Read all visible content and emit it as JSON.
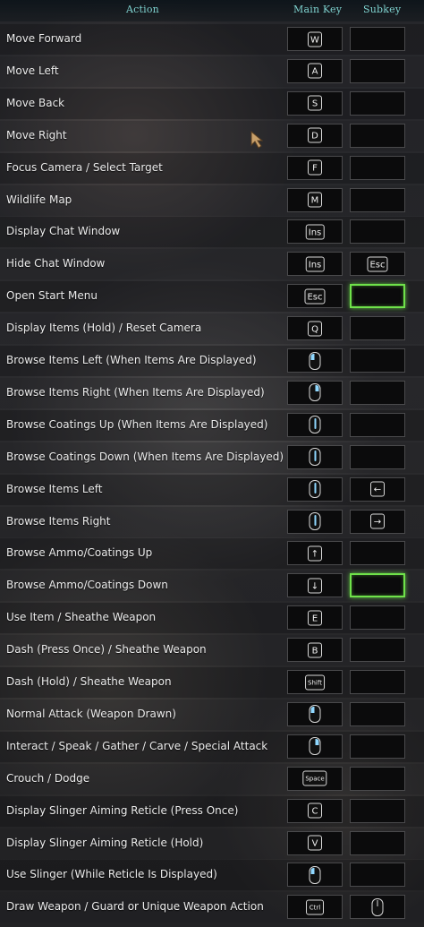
{
  "header": {
    "action": "Action",
    "main_key": "Main Key",
    "subkey": "Subkey"
  },
  "rows": [
    {
      "label": "Move Forward",
      "main": {
        "type": "key",
        "text": "W"
      },
      "sub": null
    },
    {
      "label": "Move Left",
      "main": {
        "type": "key",
        "text": "A"
      },
      "sub": null
    },
    {
      "label": "Move Back",
      "main": {
        "type": "key",
        "text": "S"
      },
      "sub": null
    },
    {
      "label": "Move Right",
      "main": {
        "type": "key",
        "text": "D"
      },
      "sub": null
    },
    {
      "label": "Focus Camera / Select Target",
      "main": {
        "type": "key",
        "text": "F"
      },
      "sub": null
    },
    {
      "label": "Wildlife Map",
      "main": {
        "type": "key",
        "text": "M"
      },
      "sub": null
    },
    {
      "label": "Display Chat Window",
      "main": {
        "type": "key",
        "text": "Ins"
      },
      "sub": null
    },
    {
      "label": "Hide Chat Window",
      "main": {
        "type": "key",
        "text": "Ins"
      },
      "sub": {
        "type": "key",
        "text": "Esc"
      }
    },
    {
      "label": "Open Start Menu",
      "main": {
        "type": "key",
        "text": "Esc"
      },
      "sub": null,
      "sub_selected": true
    },
    {
      "label": "Display Items (Hold) / Reset Camera",
      "main": {
        "type": "key",
        "text": "Q"
      },
      "sub": null
    },
    {
      "label": "Browse Items Left (When Items Are Displayed)",
      "main": {
        "type": "mouse",
        "icon": "mouse-left-click-icon"
      },
      "sub": null
    },
    {
      "label": "Browse Items Right (When Items Are Displayed)",
      "main": {
        "type": "mouse",
        "icon": "mouse-right-click-icon"
      },
      "sub": null
    },
    {
      "label": "Browse Coatings Up (When Items Are Displayed)",
      "main": {
        "type": "mouse",
        "icon": "mouse-wheel-up-icon"
      },
      "sub": null
    },
    {
      "label": "Browse Coatings Down (When Items Are Displayed)",
      "main": {
        "type": "mouse",
        "icon": "mouse-wheel-down-icon"
      },
      "sub": null
    },
    {
      "label": "Browse Items Left",
      "main": {
        "type": "mouse",
        "icon": "mouse-wheel-up-icon"
      },
      "sub": {
        "type": "key",
        "text": "←"
      }
    },
    {
      "label": "Browse Items Right",
      "main": {
        "type": "mouse",
        "icon": "mouse-wheel-down-icon"
      },
      "sub": {
        "type": "key",
        "text": "→"
      }
    },
    {
      "label": "Browse Ammo/Coatings Up",
      "main": {
        "type": "key",
        "text": "↑"
      },
      "sub": null
    },
    {
      "label": "Browse Ammo/Coatings Down",
      "main": {
        "type": "key",
        "text": "↓"
      },
      "sub": null,
      "sub_selected": true
    },
    {
      "label": "Use Item / Sheathe Weapon",
      "main": {
        "type": "key",
        "text": "E"
      },
      "sub": null
    },
    {
      "label": "Dash (Press Once) / Sheathe Weapon",
      "main": {
        "type": "key",
        "text": "B"
      },
      "sub": null
    },
    {
      "label": "Dash (Hold) / Sheathe Weapon",
      "main": {
        "type": "key",
        "text": "Shift"
      },
      "sub": null
    },
    {
      "label": "Normal Attack (Weapon Drawn)",
      "main": {
        "type": "mouse",
        "icon": "mouse-left-click-icon"
      },
      "sub": null
    },
    {
      "label": "Interact / Speak / Gather / Carve / Special Attack",
      "main": {
        "type": "mouse",
        "icon": "mouse-right-click-icon"
      },
      "sub": null
    },
    {
      "label": "Crouch / Dodge",
      "main": {
        "type": "key",
        "text": "Space"
      },
      "sub": null
    },
    {
      "label": "Display Slinger Aiming Reticle (Press Once)",
      "main": {
        "type": "key",
        "text": "C"
      },
      "sub": null
    },
    {
      "label": "Display Slinger Aiming Reticle (Hold)",
      "main": {
        "type": "key",
        "text": "V"
      },
      "sub": null
    },
    {
      "label": "Use Slinger (While Reticle Is Displayed)",
      "main": {
        "type": "mouse",
        "icon": "mouse-left-click-icon"
      },
      "sub": null
    },
    {
      "label": "Draw Weapon / Guard or Unique Weapon Action",
      "main": {
        "type": "key",
        "text": "Ctrl"
      },
      "sub": {
        "type": "mouse",
        "icon": "mouse-icon"
      }
    }
  ],
  "colors": {
    "header_text": "#7fd3d0",
    "selection": "#6fe24a",
    "mouse_highlight": "#8fd8ff"
  },
  "cursor_icon": "game-pointer-icon"
}
